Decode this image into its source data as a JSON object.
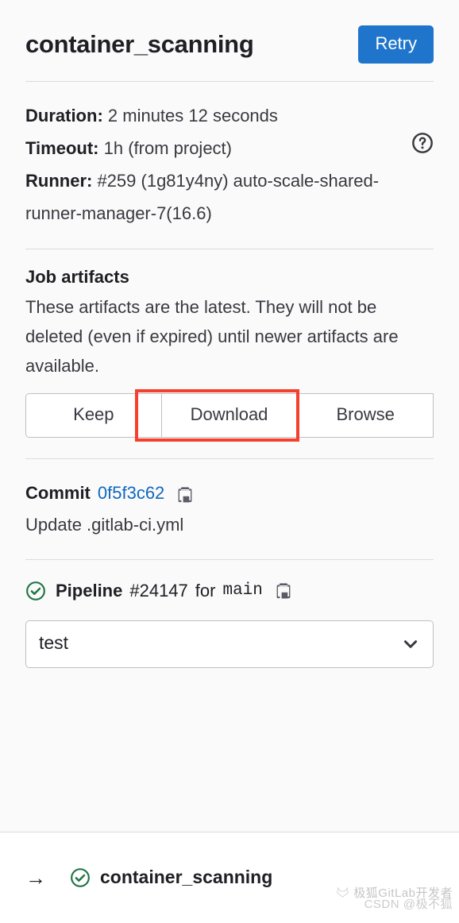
{
  "header": {
    "job_name": "container_scanning",
    "retry_label": "Retry"
  },
  "info": {
    "duration_label": "Duration:",
    "duration_value": "2 minutes 12 seconds",
    "timeout_label": "Timeout:",
    "timeout_value": "1h (from project)",
    "runner_label": "Runner:",
    "runner_value": "#259 (1g81y4ny) auto-scale-shared-runner-manager-7(16.6)",
    "help_icon": "question-circle-icon"
  },
  "artifacts": {
    "title": "Job artifacts",
    "description": "These artifacts are the latest. They will not be deleted (even if expired) until newer artifacts are available.",
    "keep_label": "Keep",
    "download_label": "Download",
    "browse_label": "Browse",
    "highlight_color": "#f5402c"
  },
  "commit": {
    "label": "Commit",
    "sha": "0f5f3c62",
    "sha_color": "#1068bf",
    "copy_icon": "clipboard-copy-icon",
    "message": "Update .gitlab-ci.yml"
  },
  "pipeline": {
    "status_icon": "status-success-icon",
    "status_color": "#217645",
    "label": "Pipeline",
    "number": "#24147",
    "for_text": "for",
    "ref": "main",
    "copy_icon": "clipboard-copy-icon"
  },
  "stage_select": {
    "value": "test",
    "chevron_icon": "chevron-down-icon"
  },
  "job_list": {
    "arrow_icon": "arrow-right-icon",
    "status_icon": "status-success-icon",
    "name": "container_scanning"
  },
  "watermark": {
    "line1": "极狐GitLab开发者",
    "line2": "CSDN @极不狐"
  },
  "colors": {
    "primary_blue": "#1f75cb",
    "panel_bg": "#fafafa",
    "divider": "#dcdcde",
    "text": "#1f1e24"
  }
}
